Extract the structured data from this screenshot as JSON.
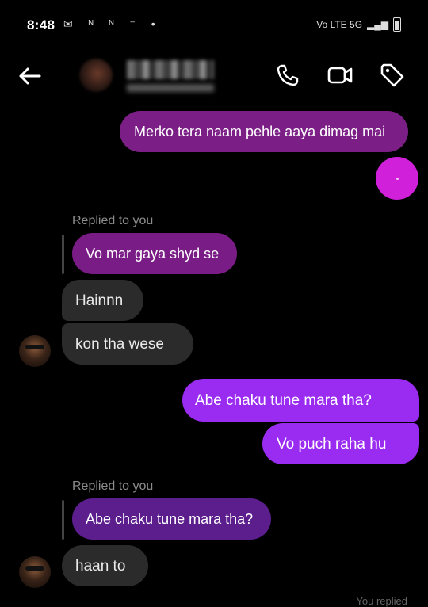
{
  "status_bar": {
    "time": "8:48",
    "left_icons": "✉ ᴺ ᴺ ⁻ •",
    "right_icons": "Vo LTE 5G"
  },
  "header": {
    "back_icon": "arrow-left-icon",
    "call_icon": "phone-icon",
    "video_icon": "video-icon",
    "tag_icon": "tag-icon"
  },
  "messages": {
    "m1": "Merko tera naam pehle aaya dimag mai",
    "reply1_label": "Replied to you",
    "reply1_quote": "Vo mar gaya shyd se",
    "m2": "Hainnn",
    "m3": "kon tha wese",
    "m4": "Abe chaku tune mara tha?",
    "m5": "Vo puch raha hu",
    "reply2_label": "Replied to you",
    "reply2_quote": "Abe chaku tune mara tha?",
    "m6": "haan to",
    "footer": "You replied"
  },
  "colors": {
    "outgoing_early": "#7b1f86",
    "outgoing": "#9a2bf0",
    "incoming": "#2b2b2b",
    "quote_purple": "#5b1e8c",
    "dot": "#d020d9"
  }
}
